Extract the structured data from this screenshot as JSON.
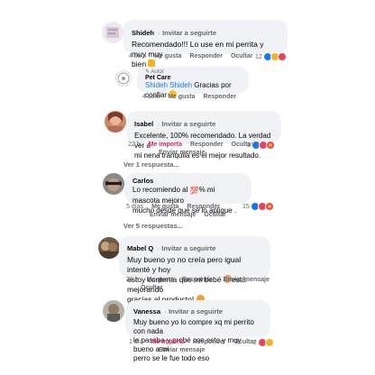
{
  "comments": [
    {
      "name": "Shideh",
      "invite": "Invitar a seguirte",
      "text_line1": "Recomendado!!! Lo use en mi perrita y muy muy",
      "text_line2": "bien",
      "time": "4 sem",
      "like": "Me gusta",
      "reply": "Responder",
      "hide": "Ocultar",
      "reactions_count": "12"
    },
    {
      "badge": "Autor",
      "name": "Pet Care",
      "mention": "Shideh Shideh",
      "text": "Gracias por confiar",
      "time": "4 sem",
      "like": "Me gusta",
      "reply": "Responder"
    },
    {
      "name": "Isabel",
      "invite": "Invitar a seguirte",
      "text_line1": "Excelente,  100% recomendado. La verdad ver a",
      "text_line2": "mi nena tranquila es el mejor resultado.",
      "time": "22 h",
      "like": "Me importa",
      "reply": "Responder",
      "hide": "Ocultar",
      "send": "Enviar mensaje",
      "reactions_count": "3"
    },
    {
      "replies": "Ver 1 respuesta..."
    },
    {
      "name": "Carlos",
      "text_line1_a": "Lo recomiendo al ",
      "text_line1_hund": "💯",
      "text_line1_b": "% mi mascota mejoro",
      "text_line2": "mucho desde que se lo aplique .",
      "time": "5 días",
      "like": "Me gusta",
      "reply": "Responder",
      "send": "Enviar mensaje",
      "hide": "Ocultar",
      "reactions_count": "15"
    },
    {
      "replies": "Ver 5 respuestas..."
    },
    {
      "name": "Mabel Q",
      "invite": "Invitar a seguirte",
      "text_line1": "Muy bueno yo no creía pero igual intenté y hoy",
      "text_line2_a": "estoy contenta que mi bebé ",
      "text_line2_b": "está mejorando",
      "text_line3": "gracias al producto!",
      "time": "21 h",
      "like": "Me gusta",
      "reply": "Responder",
      "send": "Enviar mensaje",
      "hide": "Ocultar"
    },
    {
      "name": "Vanessa",
      "invite": "Invitar a seguirte",
      "text_line1": "Muy bueno yo lo compre xq mi perrito con nada",
      "text_line2": "le pasaba y probé con esto y muy bueno a mi",
      "text_line3": "perro se le fue todo eso",
      "time": "1 día",
      "like": "Me importa",
      "reply": "Responder",
      "hide": "Ocultar",
      "send": "Enviar mensaje",
      "reactions_count": "2"
    }
  ],
  "colors": {
    "link": "#65676b",
    "bubble": "#f0f2f5",
    "liked": "#e0245e",
    "like_blue": "#1877f2"
  }
}
